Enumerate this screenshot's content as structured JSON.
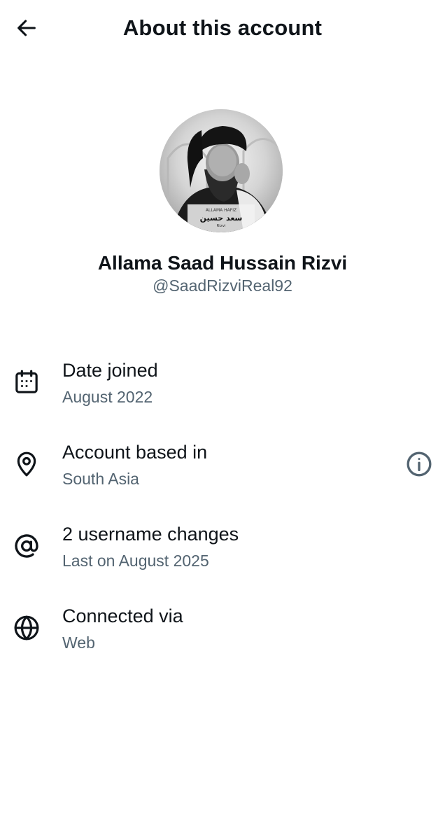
{
  "header": {
    "title": "About this account",
    "back_icon": "arrow-left-icon"
  },
  "profile": {
    "display_name": "Allama Saad Hussain Rizvi",
    "handle": "@SaadRizviReal92",
    "avatar_caption_top": "ALLAMA HAFIZ",
    "avatar_caption_main": "سعد حسین",
    "avatar_caption_sub": "Rizvi"
  },
  "rows": [
    {
      "icon": "calendar-icon",
      "title": "Date joined",
      "subtitle": "August 2022"
    },
    {
      "icon": "location-pin-icon",
      "title": "Account based in",
      "subtitle": "South Asia",
      "trailing_icon": "info-icon"
    },
    {
      "icon": "at-sign-icon",
      "title": "2 username changes",
      "subtitle": "Last on August 2025"
    },
    {
      "icon": "globe-icon",
      "title": "Connected via",
      "subtitle": "Web"
    }
  ],
  "colors": {
    "text_primary": "#0f1419",
    "text_secondary": "#536471",
    "background": "#ffffff"
  }
}
